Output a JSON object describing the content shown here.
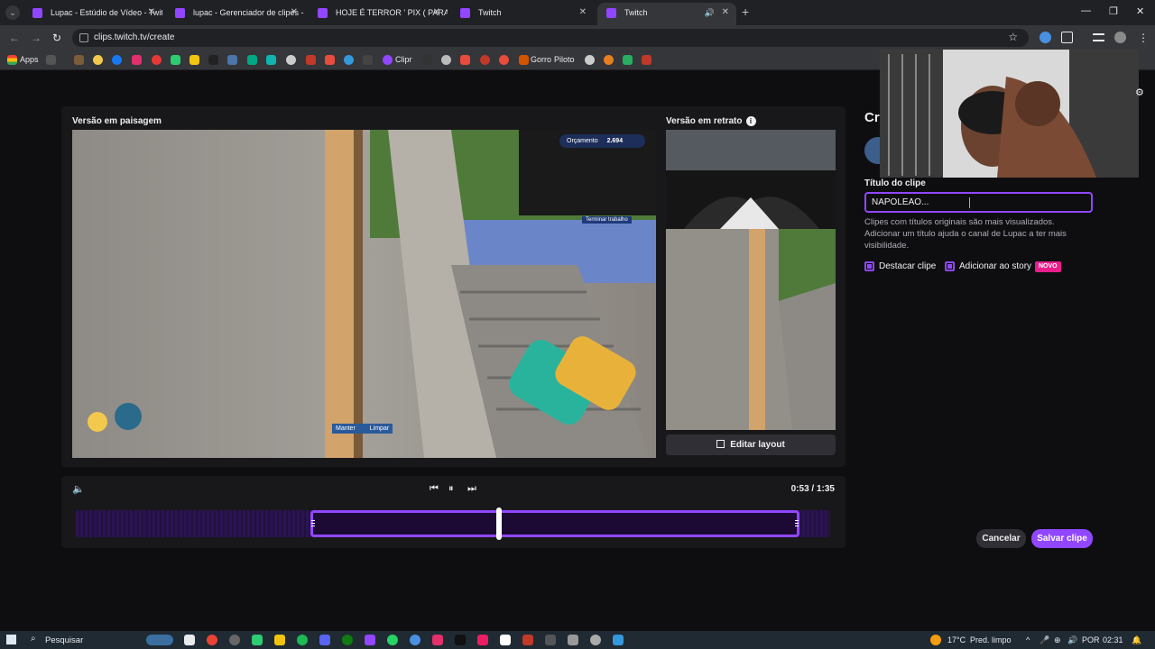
{
  "browser": {
    "tabs": [
      {
        "title": "Lupac - Estúdio de Vídeo - Twitch",
        "active": false
      },
      {
        "title": "lupac - Gerenciador de clipes - Twitch",
        "active": false
      },
      {
        "title": "HOJE É TERROR ' PIX ( PARA MAIS",
        "active": false
      },
      {
        "title": "Twitch",
        "active": false
      },
      {
        "title": "Twitch",
        "active": true
      }
    ],
    "url": "clips.twitch.tv/create",
    "bookmarks": {
      "apps": "Apps",
      "clipr": "Clipr",
      "gorro": "Gorro",
      "piloto": "Piloto"
    }
  },
  "editor": {
    "landscape_label": "Versão em paisagem",
    "portrait_label": "Versão em retrato",
    "edit_layout": "Editar layout",
    "game_hud": {
      "budget_label": "Orçamento",
      "budget_value": "2.694",
      "finish_work": "Terminar trabalho",
      "keep": "Manter",
      "clear": "Limpar"
    }
  },
  "timeline": {
    "current": "0:53",
    "total": "1:35",
    "time_display": "0:53 / 1:35",
    "selection_start_fraction": 0.31,
    "selection_end_fraction": 0.955,
    "playhead_fraction": 0.55
  },
  "panel": {
    "heading_partial": "Cr",
    "title_label": "Título do clipe",
    "title_value": "NAPOLEÃO...",
    "helper_text": "Clipes com títulos originais são mais visualizados. Adicionar um título ajuda o canal de Lupac a ter mais visibilidade.",
    "feature_clip": "Destacar clipe",
    "add_to_story": "Adicionar ao story",
    "new_badge": "NOVO",
    "cancel": "Cancelar",
    "save": "Salvar clipe"
  },
  "taskbar": {
    "search": "Pesquisar",
    "weather": "17°C",
    "weather_desc": "Pred. limpo",
    "lang": "POR",
    "clock": "02:31"
  },
  "colors": {
    "accent": "#9147ff",
    "background": "#0e0e10",
    "surface": "#18181b"
  }
}
